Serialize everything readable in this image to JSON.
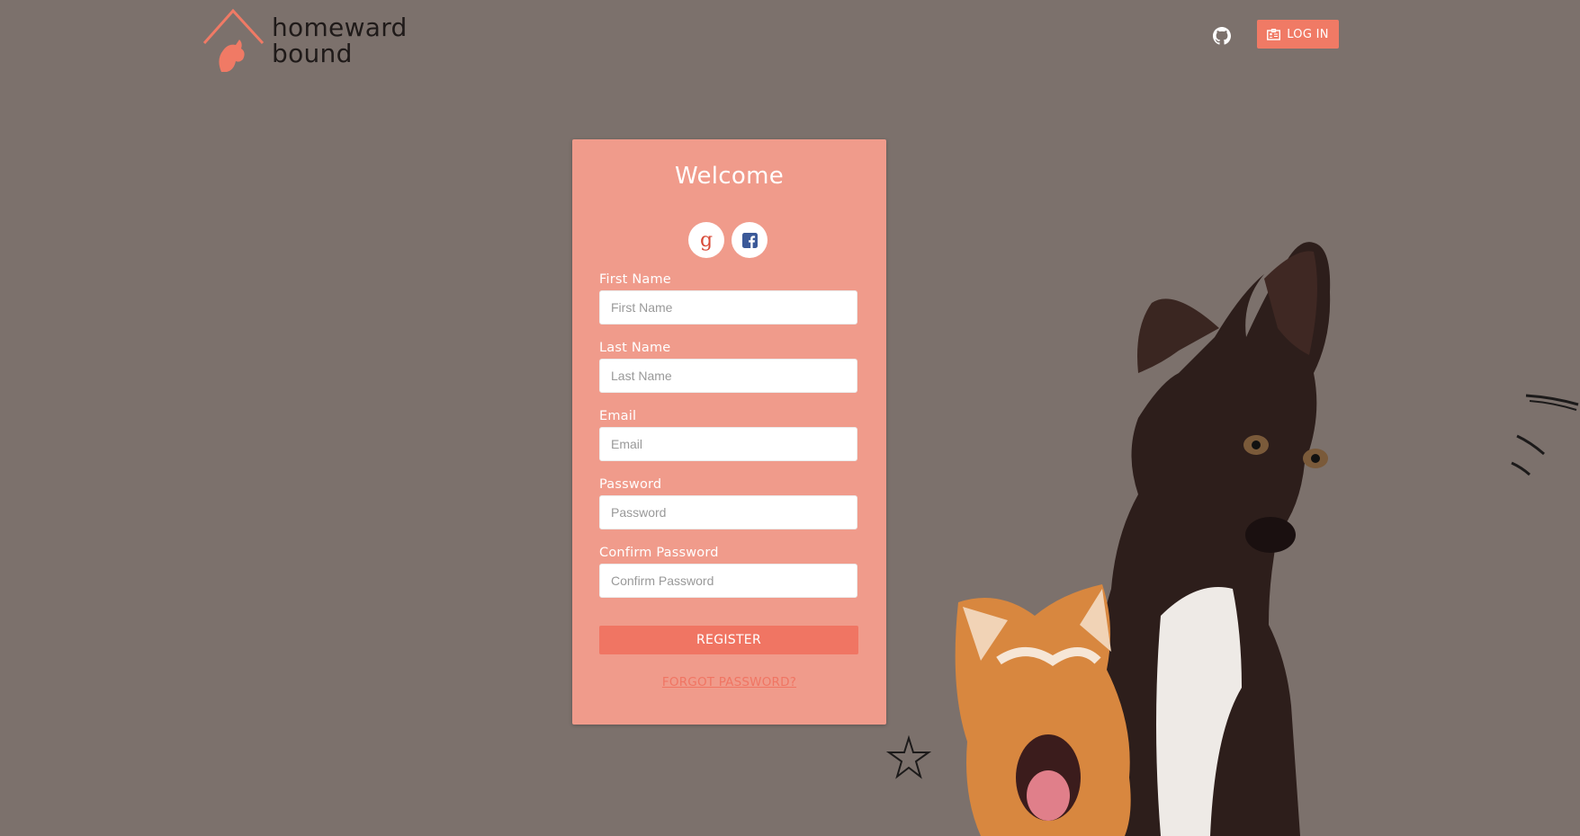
{
  "header": {
    "logo_text_line1": "homeward",
    "logo_text_line2": "bound",
    "login_label": "LOG IN",
    "icons": [
      "github-icon",
      "id-card-icon"
    ],
    "accent_color": "#f07a65"
  },
  "form": {
    "title": "Welcome",
    "social_buttons": [
      {
        "name": "google",
        "glyph": "g"
      },
      {
        "name": "facebook",
        "glyph": "f"
      }
    ],
    "fields": [
      {
        "label": "First Name",
        "placeholder": "First Name"
      },
      {
        "label": "Last Name",
        "placeholder": "Last Name"
      },
      {
        "label": "Email",
        "placeholder": "Email"
      },
      {
        "label": "Password",
        "placeholder": "Password"
      },
      {
        "label": "Confirm Password",
        "placeholder": "Confirm Password"
      }
    ],
    "register_label": "REGISTER",
    "forgot_label": "FORGOT PASSWORD?",
    "card_color": "#f09b8b",
    "button_color": "#f07563"
  },
  "background": {
    "color": "#7c716c"
  }
}
